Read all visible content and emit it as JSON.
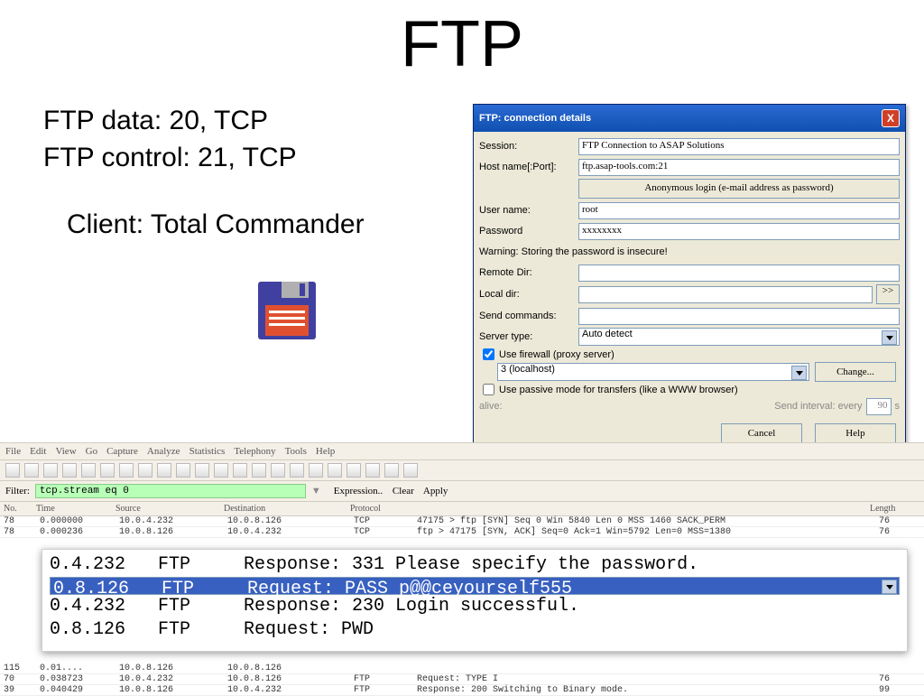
{
  "slide": {
    "title": "FTP",
    "body": {
      "line1": "FTP data: 20, TCP",
      "line2": "FTP control: 21, TCP",
      "line3": "Client: Total Commander"
    }
  },
  "dialog": {
    "title": "FTP: connection details",
    "close_x": "X",
    "labels": {
      "session": "Session:",
      "host": "Host name[:Port]:",
      "anon": "Anonymous login (e-mail address as password)",
      "user": "User name:",
      "pass": "Password",
      "warn": "Warning: Storing the password is insecure!",
      "remote": "Remote Dir:",
      "local": "Local dir:",
      "localbtn": ">>",
      "send": "Send commands:",
      "server": "Server type:",
      "firewall": "Use firewall (proxy server)",
      "passive": "Use passive mode for transfers (like a WWW browser)",
      "alive": "alive:",
      "interval_pre": "Send interval: every",
      "interval_suf": "s",
      "change": "Change...",
      "cancel": "Cancel",
      "help": "Help"
    },
    "values": {
      "session": "FTP Connection to ASAP Solutions",
      "host": "ftp.asap-tools.com:21",
      "user": "root",
      "pass": "xxxxxxxx",
      "server": "Auto detect",
      "firewall_option": "3 (localhost)",
      "interval": "90"
    }
  },
  "wireshark": {
    "menu": [
      "File",
      "Edit",
      "View",
      "Go",
      "Capture",
      "Analyze",
      "Statistics",
      "Telephony",
      "Tools",
      "Help"
    ],
    "filter_label": "Filter:",
    "filter_value": "tcp.stream eq 0",
    "filter_btns": [
      "Expression..",
      "Clear",
      "Apply"
    ],
    "cols": [
      "No.",
      "Time",
      "Source",
      "Destination",
      "Protocol",
      "",
      "Length"
    ],
    "small": [
      {
        "no": "78",
        "time": "0.000000",
        "src": "10.0.4.232",
        "dst": "10.0.8.126",
        "proto": "TCP",
        "info": "47175 > ftp [SYN] Seq 0 Win 5840 Len 0 MSS 1460 SACK_PERM",
        "len": "76"
      },
      {
        "no": "78",
        "time": "0.000236",
        "src": "10.0.8.126",
        "dst": "10.0.4.232",
        "proto": "TCP",
        "info": "ftp > 47175 [SYN, ACK] Seq=0 Ack=1 Win=5792 Len=0 MSS=1380",
        "len": "76"
      }
    ],
    "zoom": [
      {
        "ip": "0.4.232",
        "proto": "FTP",
        "info": "Response: 331 Please specify the password."
      },
      {
        "ip": "0.8.126",
        "proto": "FTP",
        "info": "Request: PASS p@@ceyourself555",
        "sel": true
      },
      {
        "ip": "0.4.232",
        "proto": "FTP",
        "info": "Response: 230 Login successful."
      },
      {
        "ip": "0.8.126",
        "proto": "FTP",
        "info": "Request: PWD"
      }
    ],
    "zoom_header": {
      "ip": "",
      "proto": "",
      "info": ""
    },
    "tail": [
      {
        "no": "115",
        "time": "0.01....",
        "src": "10.0.8.126",
        "dst": "10.0.8.126",
        "proto": "",
        "info": "",
        "len": ""
      },
      {
        "no": "70",
        "time": "0.038723",
        "src": "10.0.4.232",
        "dst": "10.0.8.126",
        "proto": "FTP",
        "info": "Request: TYPE I",
        "len": "76"
      },
      {
        "no": "39",
        "time": "0.040429",
        "src": "10.0.8.126",
        "dst": "10.0.4.232",
        "proto": "FTP",
        "info": "Response: 200 Switching to Binary mode.",
        "len": "99"
      }
    ]
  }
}
